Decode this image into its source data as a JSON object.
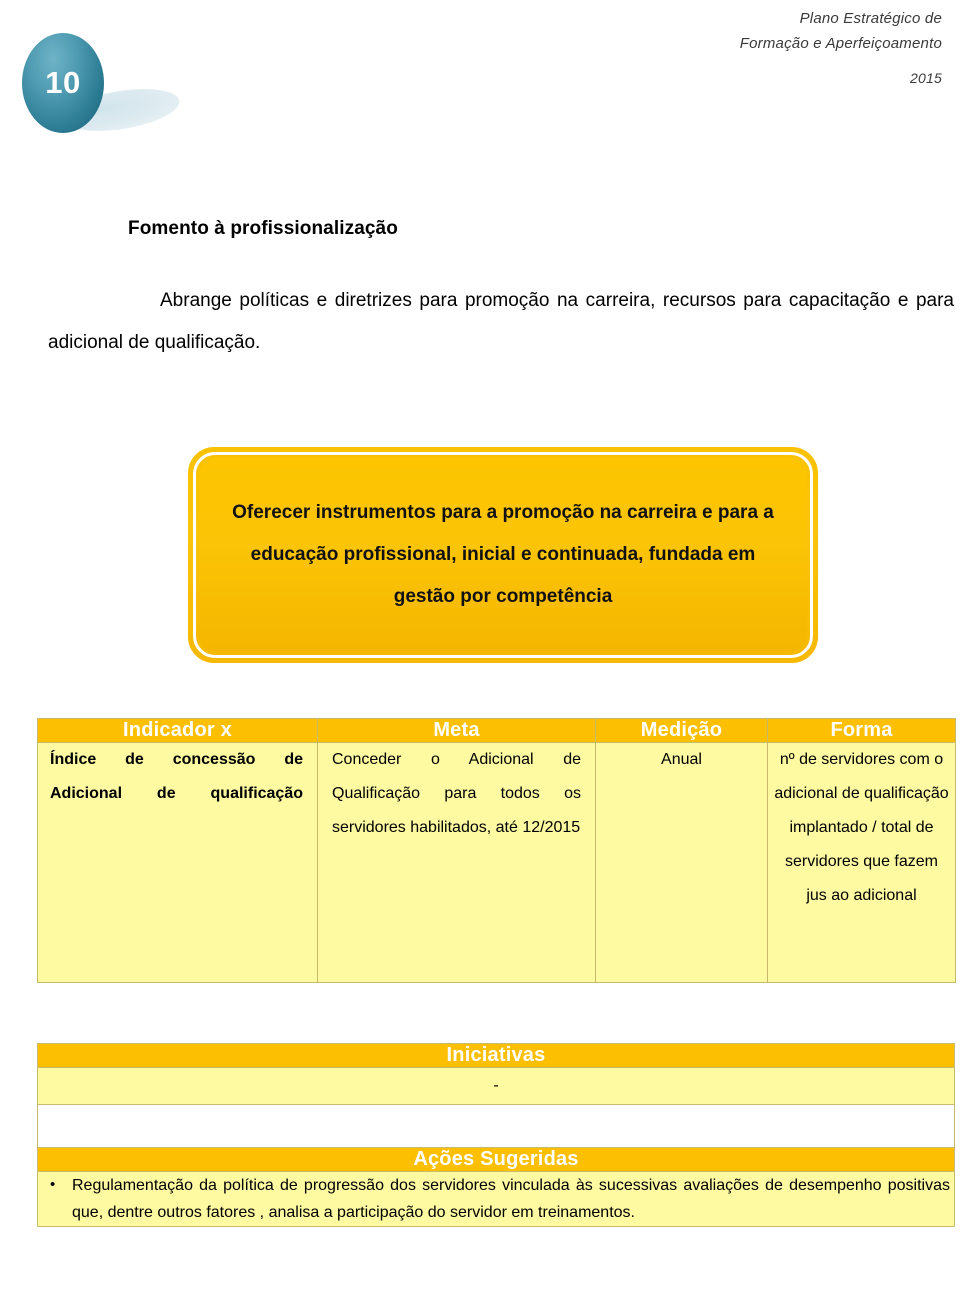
{
  "header": {
    "doc_title_line1": "Plano Estratégico de",
    "doc_title_line2": "Formação e Aperfeiçoamento",
    "year": "2015",
    "page_number": "10"
  },
  "section": {
    "heading": "Fomento à profissionalização",
    "intro": "Abrange políticas e diretrizes para promoção na carreira, recursos para capacitação e para adicional de qualificação."
  },
  "objective": {
    "text": "Oferecer instrumentos para a promoção na carreira e para a educação profissional, inicial e continuada, fundada em gestão por competência"
  },
  "indicator_table": {
    "headers": [
      "Indicador x",
      "Meta",
      "Medição",
      "Forma"
    ],
    "rows": [
      {
        "indicador": "Índice de concessão de Adicional de qualificação",
        "meta": "Conceder o Adicional de Qualificação para todos os servidores habilitados, até 12/2015",
        "medicao": "Anual",
        "forma": "nº de servidores com o adicional de qualificação implantado / total de servidores que fazem jus ao adicional"
      }
    ]
  },
  "initiatives": {
    "header": "Iniciativas",
    "value": "-"
  },
  "suggested_actions": {
    "header": "Ações Sugeridas",
    "items": [
      "Regulamentação da política de progressão dos servidores vinculada às sucessivas avaliações de desempenho positivas que, dentre outros fatores , analisa a  participação do servidor em treinamentos."
    ]
  }
}
